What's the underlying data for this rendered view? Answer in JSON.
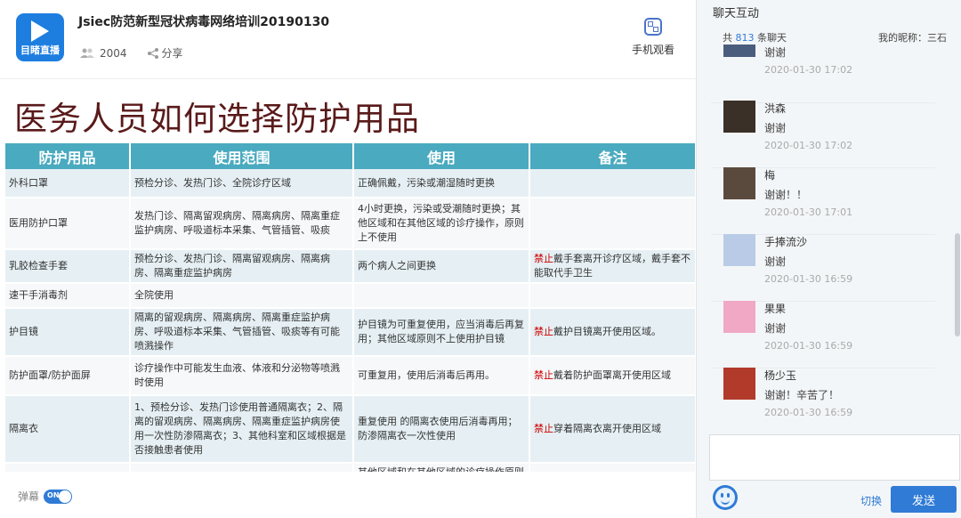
{
  "header": {
    "logo_text": "目睹直播",
    "title": "Jsiec防范新型冠状病毒网络培训20190130",
    "views": "2004",
    "share_label": "分享",
    "mobile_label": "手机观看"
  },
  "slide": {
    "title": "医务人员如何选择防护用品",
    "columns": [
      "防护用品",
      "使用范围",
      "使用",
      "备注"
    ],
    "rows": [
      [
        "外科口罩",
        "预检分诊、发热门诊、全院诊疗区域",
        "正确佩戴，污染或潮湿随时更换",
        ""
      ],
      [
        "医用防护口罩",
        "发热门诊、隔离留观病房、隔离病房、隔离重症监护病房、呼吸道标本采集、气管插管、吸痰",
        "4小时更换，污染或受潮随时更换；其他区域和在其他区域的诊疗操作，原则上不使用",
        ""
      ],
      [
        "乳胶检查手套",
        "预检分诊、发热门诊、隔离留观病房、隔离病房、隔离重症监护病房",
        "两个病人之间更换",
        "戴手套离开诊疗区域，戴手套不能取代手卫生"
      ],
      [
        "速干手消毒剂",
        "全院使用",
        "",
        ""
      ],
      [
        "护目镜",
        "隔离的留观病房、隔离病房、隔离重症监护病房、呼吸道标本采集、气管插管、吸痰等有可能喷溅操作",
        "护目镜为可重复使用，应当消毒后再复用；其他区域原则不上使用护目镜",
        "戴护目镜离开使用区域。"
      ],
      [
        "防护面罩/防护面屏",
        "诊疗操作中可能发生血液、体液和分泌物等喷溅时使用",
        "可重复用，使用后消毒后再用。",
        "戴着防护面罩离开使用区域"
      ],
      [
        "隔离衣",
        "1、预检分诊、发热门诊使用普通隔离衣；2、隔离的留观病房、隔离病房、隔离重症监护病房使用一次性防渗隔离衣；3、其他科室和区域根据是否接触患者使用",
        "重复使用 的隔离衣使用后消毒再用；防渗隔离衣一次性使用",
        "穿着隔离衣离开使用区域"
      ],
      [
        "",
        "",
        "其他区域和在其他区域的诊疗操作原则上不使用防护服。",
        ""
      ]
    ],
    "forbid_label": "禁止"
  },
  "footer": {
    "danmu_label": "弹幕",
    "toggle_label": "ON"
  },
  "chat": {
    "title": "聊天互动",
    "count_prefix": "共",
    "count": "813",
    "count_suffix": "条聊天",
    "nickname_label": "我的昵称：三石",
    "messages": [
      {
        "name": "",
        "text": "谢谢",
        "time": "2020-01-30 17:02"
      },
      {
        "name": "洪森",
        "text": "谢谢",
        "time": "2020-01-30 17:02"
      },
      {
        "name": "梅",
        "text": "谢谢！！",
        "time": "2020-01-30 17:01"
      },
      {
        "name": "手捧流沙",
        "text": "谢谢",
        "time": "2020-01-30 16:59"
      },
      {
        "name": "果果",
        "text": "谢谢",
        "time": "2020-01-30 16:59"
      },
      {
        "name": "杨少玉",
        "text": "谢谢！辛苦了！",
        "time": "2020-01-30 16:59"
      }
    ],
    "switch_label": "切换",
    "send_label": "发送"
  }
}
